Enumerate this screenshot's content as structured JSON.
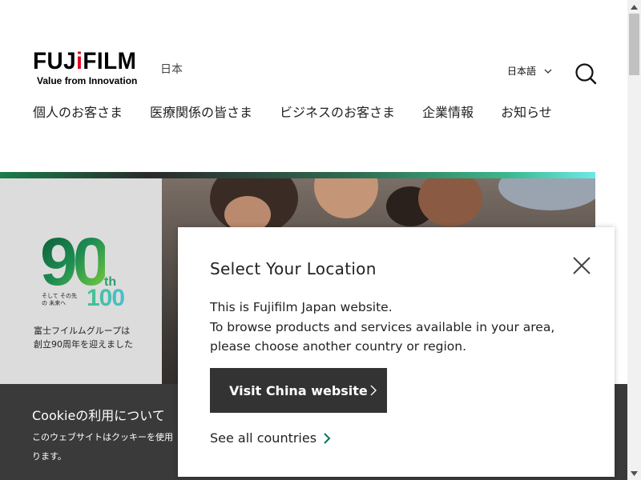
{
  "header": {
    "logo_prefix": "FUJ",
    "logo_i": "i",
    "logo_suffix": "FILM",
    "logo_tagline": "Value from Innovation",
    "region": "日本",
    "language": "日本語",
    "lang_icon": "chevron-down-icon",
    "search_icon": "search-icon"
  },
  "nav": {
    "items": [
      {
        "label": "個人のお客さま"
      },
      {
        "label": "医療関係の皆さま"
      },
      {
        "label": "ビジネスのお客さま"
      },
      {
        "label": "企業情報"
      },
      {
        "label": "お知らせ"
      }
    ]
  },
  "hero": {
    "badge_90": "90",
    "badge_th": "th",
    "badge_small": "そして その先の 未来へ",
    "badge_100": "100",
    "anniversary_line1": "富士フイルムグループは",
    "anniversary_line2": "創立90周年を迎えました"
  },
  "cookie": {
    "title": "Cookieの利用について",
    "text_line1": "このウェブサイトはクッキーを使用",
    "text_line2": "ります。"
  },
  "modal": {
    "title": "Select Your Location",
    "line1": "This is Fujifilm Japan website.",
    "line2": "To browse products and services available in your area,",
    "line3": "please choose another country or region.",
    "primary_button": "Visit China website",
    "link": "See all countries",
    "close_icon": "close-icon",
    "colors": {
      "button_bg": "#333333",
      "link_arrow": "#00785a"
    }
  }
}
